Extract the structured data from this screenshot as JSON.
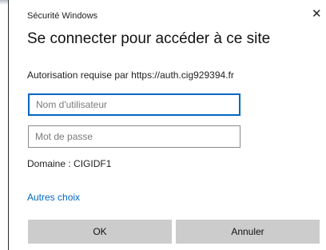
{
  "dialog": {
    "caption": "Sécurité Windows",
    "title": "Se connecter pour accéder à ce site",
    "authorization": "Autorisation requise par https://auth.cig929394.fr",
    "username_placeholder": "Nom d'utilisateur",
    "password_placeholder": "Mot de passe",
    "domain": "Domaine : CIGIDF1",
    "more_choices": "Autres choix",
    "ok_label": "OK",
    "cancel_label": "Annuler",
    "close_glyph": "✕"
  },
  "colors": {
    "accent": "#0067c0",
    "button_bg": "#cccccc"
  }
}
